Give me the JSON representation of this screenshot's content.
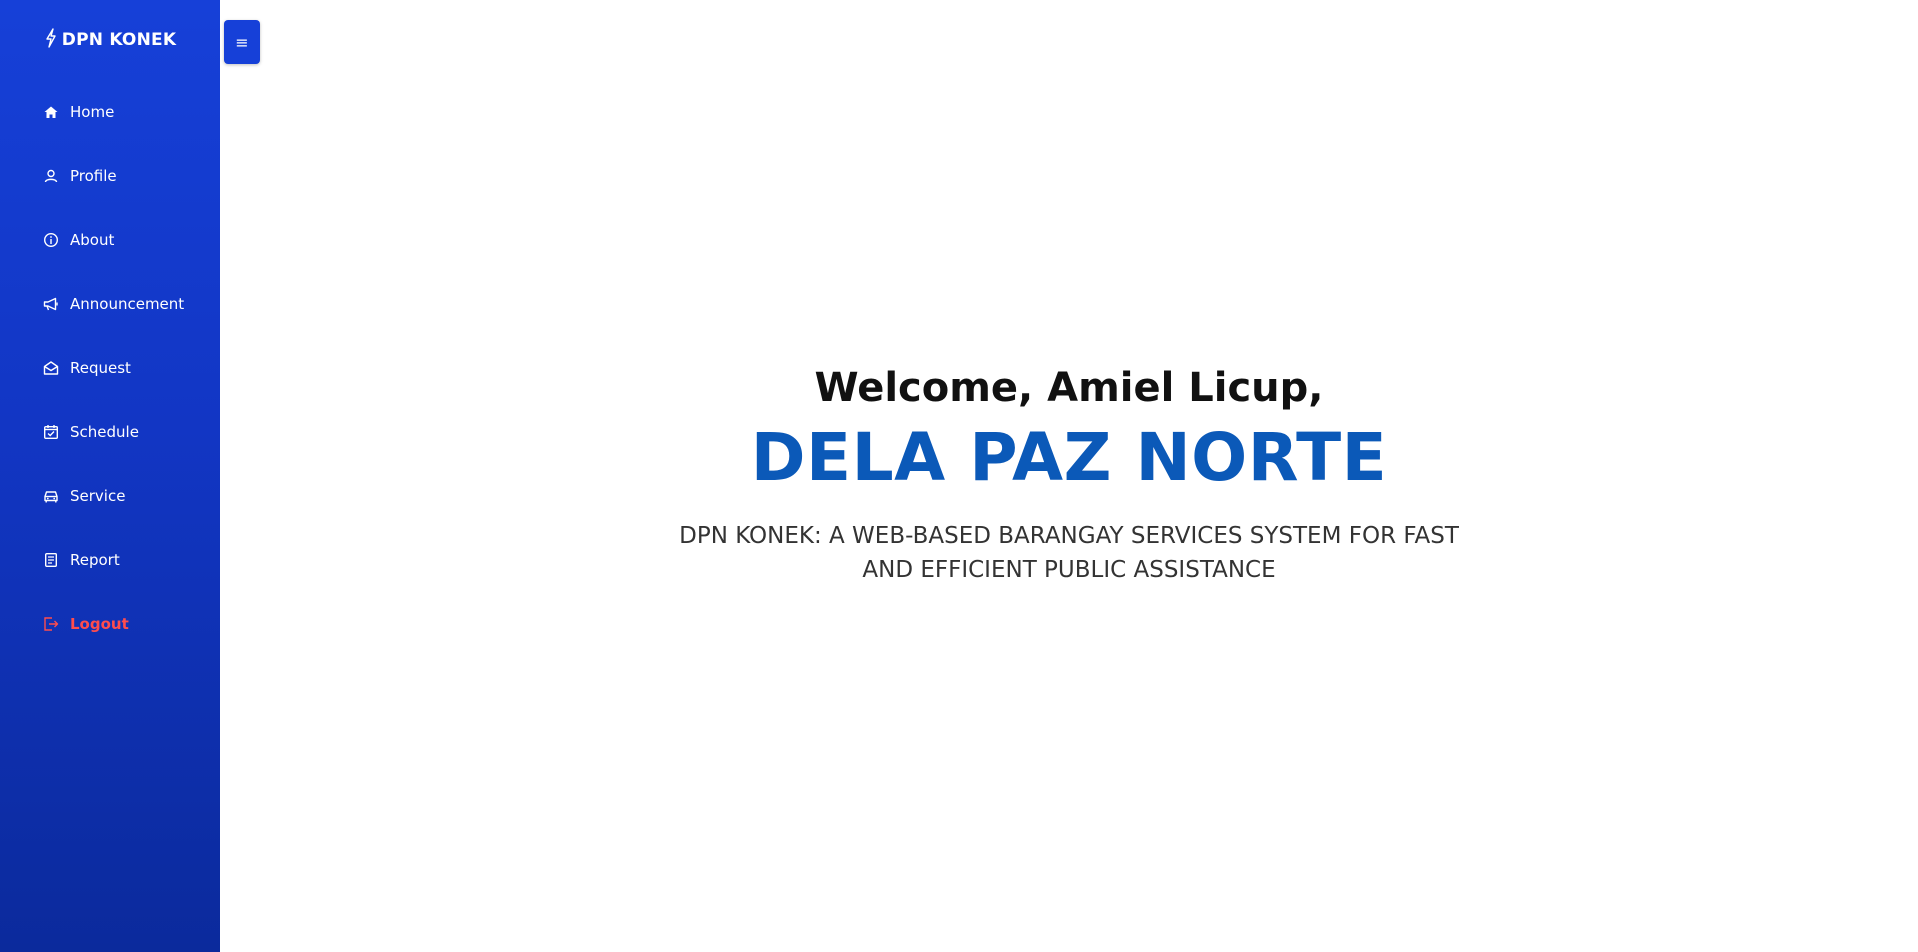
{
  "sidebar": {
    "brand": "DPN KONEK",
    "items": [
      {
        "label": "Home",
        "icon": "home-icon"
      },
      {
        "label": "Profile",
        "icon": "user-icon"
      },
      {
        "label": "About",
        "icon": "info-icon"
      },
      {
        "label": "Announcement",
        "icon": "megaphone-icon"
      },
      {
        "label": "Request",
        "icon": "envelope-icon"
      },
      {
        "label": "Schedule",
        "icon": "calendar-check-icon"
      },
      {
        "label": "Service",
        "icon": "car-icon"
      },
      {
        "label": "Report",
        "icon": "report-icon"
      },
      {
        "label": "Logout",
        "icon": "logout-icon"
      }
    ]
  },
  "toggle": {
    "label": "≡"
  },
  "main": {
    "welcome": "Welcome, Amiel Licup,",
    "title": "DELA PAZ NORTE",
    "tagline": "DPN KONEK: A WEB-BASED BARANGAY SERVICES SYSTEM FOR FAST AND EFFICIENT PUBLIC ASSISTANCE"
  },
  "colors": {
    "sidebar_top": "#1640d8",
    "sidebar_bottom": "#0b2a9c",
    "title": "#0b59b8",
    "logout": "#ff4d4d"
  }
}
